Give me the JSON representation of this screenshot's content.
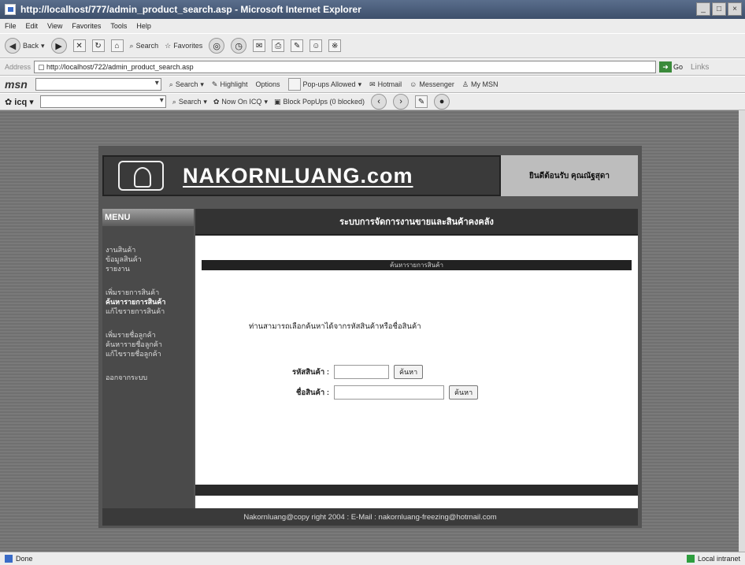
{
  "window": {
    "title": "http://localhost/777/admin_product_search.asp - Microsoft Internet Explorer"
  },
  "menubar": [
    "File",
    "Edit",
    "View",
    "Favorites",
    "Tools",
    "Help"
  ],
  "toolbar": {
    "back": "Back",
    "search": "Search",
    "favorites": "Favorites"
  },
  "address": {
    "label": "Address",
    "url": "http://localhost/722/admin_product_search.asp",
    "go": "Go",
    "links": "Links"
  },
  "msn": {
    "logo": "msn",
    "search": "Search",
    "highlight": "Highlight",
    "options": "Options",
    "popups": "Pop-ups Allowed",
    "hotmail": "Hotmail",
    "messenger": "Messenger",
    "mymsn": "My MSN"
  },
  "icq": {
    "logo": "icq",
    "search": "Search",
    "now_on": "Now On ICQ",
    "block": "Block PopUps (0 blocked)"
  },
  "site": {
    "brand": "NAKORNLUANG.com",
    "welcome": "ยินดีต้อนรับ คุณณัฐสุดา",
    "menu_title": "MENU",
    "menu_group1": [
      "งานสินค้า",
      "ข้อมูลสินค้า",
      "รายงาน"
    ],
    "menu_group2": [
      "เพิ่มรายการสินค้า",
      "ค้นหารายการสินค้า",
      "แก้ไขรายการสินค้า"
    ],
    "menu_group3": [
      "เพิ่มรายชื่อลูกค้า",
      "ค้นหารายชื่อลูกค้า",
      "แก้ไขรายชื่อลูกค้า"
    ],
    "logout": "ออกจากระบบ",
    "main_title": "ระบบการจัดการงานขายและสินค้าคงคลัง",
    "sub_title": "ค้นหารายการสินค้า",
    "instruction": "ท่านสามารถเลือกค้นหาได้จากรหัสสินค้าหรือชื่อสินค้า",
    "code_label": "รหัสสินค้า :",
    "name_label": "ชื่อสินค้า :",
    "search_btn": "ค้นหา",
    "footer": "Nakornluang@copy right 2004 : E-Mail : nakornluang-freezing@hotmail.com"
  },
  "status": {
    "left": "Done",
    "right": "Local intranet"
  }
}
